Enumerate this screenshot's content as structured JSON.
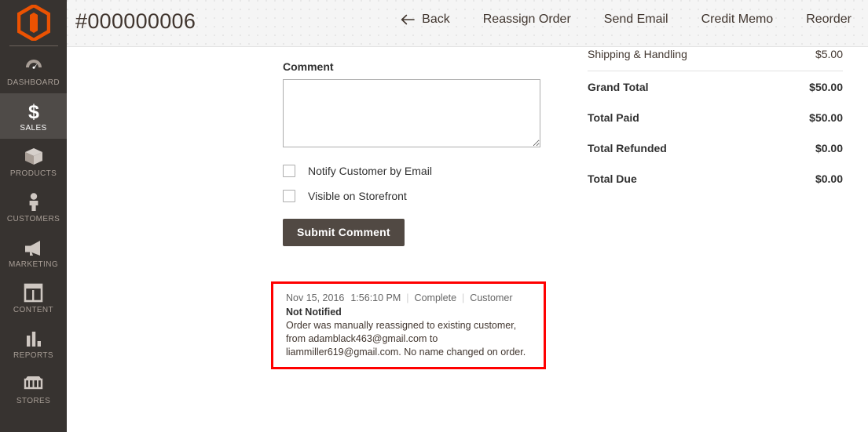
{
  "sidebar": {
    "logo_name": "magento-logo",
    "items": [
      {
        "label": "DASHBOARD",
        "icon": "dashboard-gauge-icon",
        "active": false
      },
      {
        "label": "SALES",
        "icon": "dollar-sign-icon",
        "active": true
      },
      {
        "label": "PRODUCTS",
        "icon": "box-icon",
        "active": false
      },
      {
        "label": "CUSTOMERS",
        "icon": "person-icon",
        "active": false
      },
      {
        "label": "MARKETING",
        "icon": "megaphone-icon",
        "active": false
      },
      {
        "label": "CONTENT",
        "icon": "layout-page-icon",
        "active": false
      },
      {
        "label": "REPORTS",
        "icon": "bar-chart-icon",
        "active": false
      },
      {
        "label": "STORES",
        "icon": "storefront-icon",
        "active": false
      }
    ]
  },
  "header": {
    "title": "#000000006",
    "actions": [
      {
        "label": "Back",
        "icon": "arrow-left-icon"
      },
      {
        "label": "Reassign Order",
        "icon": ""
      },
      {
        "label": "Send Email",
        "icon": ""
      },
      {
        "label": "Credit Memo",
        "icon": ""
      },
      {
        "label": "Reorder",
        "icon": ""
      }
    ]
  },
  "comment_form": {
    "label": "Comment",
    "textarea_value": "",
    "textarea_placeholder": "",
    "checkboxes": [
      {
        "label": "Notify Customer by Email",
        "checked": false
      },
      {
        "label": "Visible on Storefront",
        "checked": false
      }
    ],
    "submit_label": "Submit Comment"
  },
  "history_note": {
    "highlight_color": "#ff0000",
    "date": "Nov 15, 2016",
    "time": "1:56:10 PM",
    "status": "Complete",
    "visibility": "Customer",
    "notified": "Not Notified",
    "body": "Order was manually reassigned to existing customer, from adamblack463@gmail.com to liammiller619@gmail.com. No name changed on order."
  },
  "totals": {
    "rows": [
      {
        "label": "Shipping & Handling",
        "value": "$5.00",
        "emphasis": "normal"
      },
      {
        "label": "Grand Total",
        "value": "$50.00",
        "emphasis": "bold"
      },
      {
        "label": "Total Paid",
        "value": "$50.00",
        "emphasis": "bold"
      },
      {
        "label": "Total Refunded",
        "value": "$0.00",
        "emphasis": "bold"
      },
      {
        "label": "Total Due",
        "value": "$0.00",
        "emphasis": "bold"
      }
    ]
  }
}
